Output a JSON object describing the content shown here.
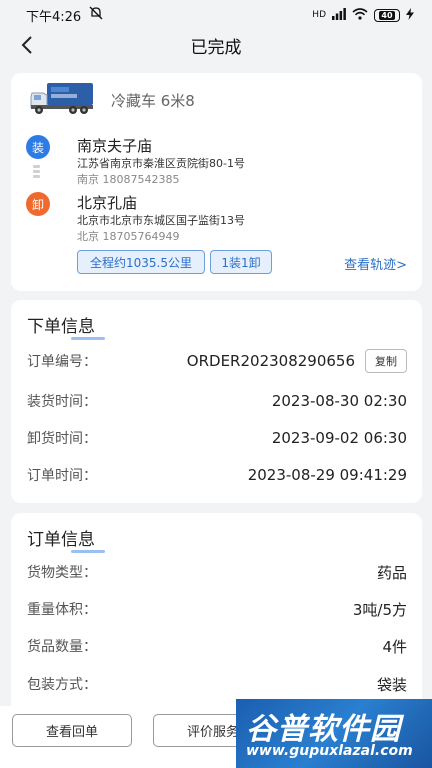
{
  "status_bar": {
    "time": "下午4:26",
    "network": "HD",
    "battery": "40"
  },
  "nav": {
    "title": "已完成"
  },
  "vehicle": {
    "type": "冷藏车 6米8"
  },
  "route": {
    "load": {
      "badge": "装",
      "name": "南京夫子庙",
      "address": "江苏省南京市秦淮区贡院街80-1号",
      "contact": "南京 18087542385"
    },
    "unload": {
      "badge": "卸",
      "name": "北京孔庙",
      "address": "北京市北京市东城区国子监街13号",
      "contact": "北京 18705764949"
    },
    "distance_tag": "全程约1035.5公里",
    "stops_tag": "1装1卸",
    "track_link": "查看轨迹>"
  },
  "order_info": {
    "title": "下单信息",
    "rows": [
      {
        "label": "订单编号：",
        "value": "ORDER202308290656"
      },
      {
        "label": "装货时间：",
        "value": "2023-08-30 02:30"
      },
      {
        "label": "卸货时间：",
        "value": "2023-09-02 06:30"
      },
      {
        "label": "订单时间：",
        "value": "2023-08-29 09:41:29"
      }
    ],
    "copy_label": "复制"
  },
  "goods_info": {
    "title": "订单信息",
    "rows": [
      {
        "label": "货物类型：",
        "value": "药品"
      },
      {
        "label": "重量体积：",
        "value": "3吨/5方"
      },
      {
        "label": "货品数量：",
        "value": "4件"
      },
      {
        "label": "包装方式：",
        "value": "袋装"
      }
    ]
  },
  "bottom_bar": {
    "receipt_button": "查看回单",
    "review_button": "评价服务"
  },
  "watermark": {
    "title": "谷普软件园",
    "url": "www.gupuxlazal.com"
  }
}
